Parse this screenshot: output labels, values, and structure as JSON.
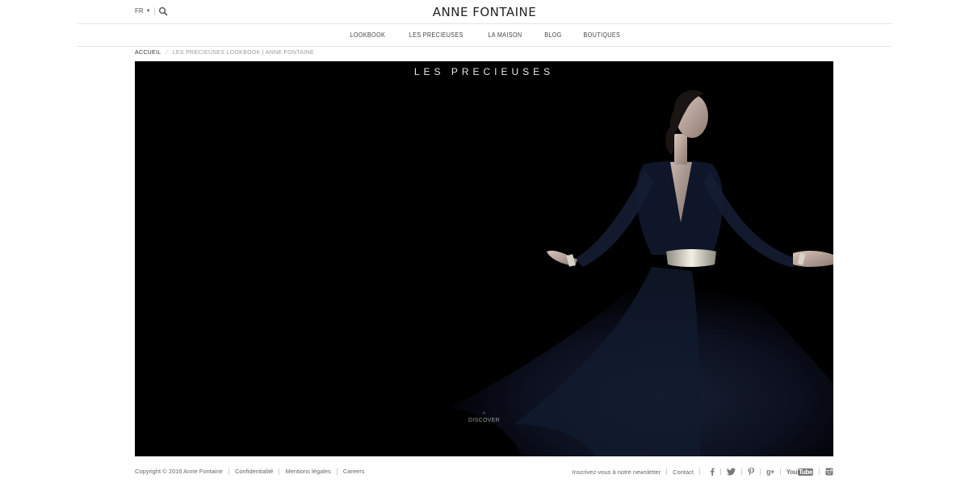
{
  "header": {
    "language": "FR",
    "brand": "ANNE FONTAINE"
  },
  "nav": {
    "items": [
      {
        "label": "LOOKBOOK"
      },
      {
        "label": "LES PRECIEUSES"
      },
      {
        "label": "LA MAISON"
      },
      {
        "label": "BLOG"
      },
      {
        "label": "BOUTIQUES"
      }
    ]
  },
  "breadcrumb": {
    "home": "ACCUEIL",
    "separator": "/",
    "current": "LES PRECIEUSES LOOKBOOK | ANNE FONTAINE"
  },
  "hero": {
    "title": "LES PRECIEUSES",
    "cta": "DISCOVER",
    "cta_icon": "chevron-up-icon"
  },
  "footer": {
    "copyright": "Copyright © 2016 Anne Fontaine",
    "links": [
      "Confidentialité",
      "Mentions légales",
      "Careers"
    ],
    "newsletter": "Inscrivez-vous à notre newsletter",
    "contact": "Contact",
    "social": [
      {
        "icon": "facebook-icon",
        "glyph": "f"
      },
      {
        "icon": "twitter-icon",
        "glyph": "t"
      },
      {
        "icon": "pinterest-icon",
        "glyph": "p"
      },
      {
        "icon": "google-plus-icon",
        "glyph": "g+"
      },
      {
        "icon": "youtube-icon",
        "glyph": "YouTube"
      },
      {
        "icon": "instagram-icon",
        "glyph": "ig"
      }
    ]
  },
  "colors": {
    "hero_background": "#000000",
    "text": "#333333",
    "divider": "#e2e2e2"
  }
}
